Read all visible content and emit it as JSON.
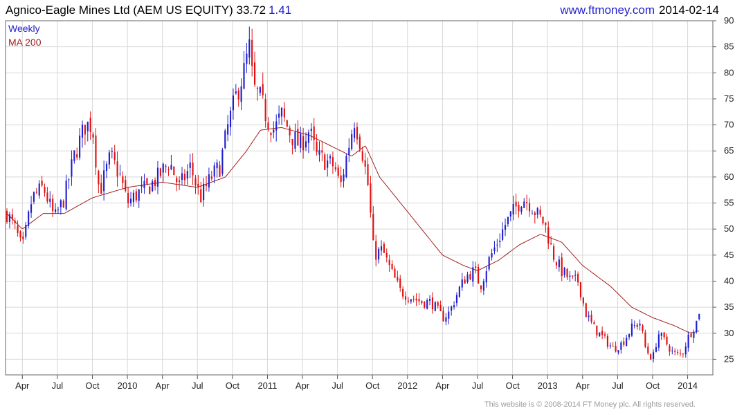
{
  "header": {
    "title": "Agnico-Eagle Mines Ltd (AEM US EQUITY) 33.72",
    "change": "1.41",
    "site": "www.ftmoney.com",
    "date": "2014-02-14"
  },
  "footer": {
    "copyright": "This website is © 2008-2014 FT Money plc. All rights reserved."
  },
  "colors": {
    "up": "#1f1fcf",
    "down": "#e01010",
    "ma": "#a02020",
    "grid": "#d8d8d8"
  },
  "chart_data": {
    "type": "candlestick",
    "frequency": "Weekly",
    "legend": [
      "Weekly",
      "MA 200"
    ],
    "legend_position": "top-left",
    "grid": true,
    "x_range": [
      2009.13,
      2014.18
    ],
    "ylim": [
      22,
      90
    ],
    "y_ticks": [
      25,
      30,
      35,
      40,
      45,
      50,
      55,
      60,
      65,
      70,
      75,
      80,
      85,
      90
    ],
    "x_ticks": [
      {
        "label": "Apr",
        "t": 2009.25
      },
      {
        "label": "Jul",
        "t": 2009.5
      },
      {
        "label": "Oct",
        "t": 2009.75
      },
      {
        "label": "2010",
        "t": 2010.0
      },
      {
        "label": "Apr",
        "t": 2010.25
      },
      {
        "label": "Jul",
        "t": 2010.5
      },
      {
        "label": "Oct",
        "t": 2010.75
      },
      {
        "label": "2011",
        "t": 2011.0
      },
      {
        "label": "Apr",
        "t": 2011.25
      },
      {
        "label": "Jul",
        "t": 2011.5
      },
      {
        "label": "Oct",
        "t": 2011.75
      },
      {
        "label": "2012",
        "t": 2012.0
      },
      {
        "label": "Apr",
        "t": 2012.25
      },
      {
        "label": "Jul",
        "t": 2012.5
      },
      {
        "label": "Oct",
        "t": 2012.75
      },
      {
        "label": "2013",
        "t": 2013.0
      },
      {
        "label": "Apr",
        "t": 2013.25
      },
      {
        "label": "Jul",
        "t": 2013.5
      },
      {
        "label": "Oct",
        "t": 2013.75
      },
      {
        "label": "2014",
        "t": 2014.0
      }
    ],
    "close_anchors": [
      [
        2009.14,
        53
      ],
      [
        2009.2,
        50
      ],
      [
        2009.25,
        46
      ],
      [
        2009.32,
        56
      ],
      [
        2009.4,
        58
      ],
      [
        2009.48,
        52
      ],
      [
        2009.55,
        56
      ],
      [
        2009.62,
        64
      ],
      [
        2009.7,
        70
      ],
      [
        2009.75,
        70
      ],
      [
        2009.8,
        57
      ],
      [
        2009.88,
        64
      ],
      [
        2009.95,
        60
      ],
      [
        2010.0,
        55
      ],
      [
        2010.08,
        57
      ],
      [
        2010.15,
        58
      ],
      [
        2010.22,
        60
      ],
      [
        2010.3,
        63
      ],
      [
        2010.37,
        58
      ],
      [
        2010.45,
        62
      ],
      [
        2010.52,
        56
      ],
      [
        2010.6,
        60
      ],
      [
        2010.66,
        62
      ],
      [
        2010.72,
        70
      ],
      [
        2010.78,
        76
      ],
      [
        2010.83,
        80
      ],
      [
        2010.87,
        85
      ],
      [
        2010.9,
        77
      ],
      [
        2010.95,
        75
      ],
      [
        2011.0,
        71
      ],
      [
        2011.05,
        69
      ],
      [
        2011.1,
        72
      ],
      [
        2011.17,
        68
      ],
      [
        2011.23,
        66
      ],
      [
        2011.3,
        69
      ],
      [
        2011.35,
        64
      ],
      [
        2011.42,
        63
      ],
      [
        2011.48,
        62
      ],
      [
        2011.52,
        58
      ],
      [
        2011.58,
        66
      ],
      [
        2011.62,
        71
      ],
      [
        2011.67,
        66
      ],
      [
        2011.72,
        58
      ],
      [
        2011.76,
        45
      ],
      [
        2011.82,
        46
      ],
      [
        2011.88,
        42
      ],
      [
        2011.95,
        38
      ],
      [
        2012.02,
        37
      ],
      [
        2012.1,
        36
      ],
      [
        2012.17,
        36
      ],
      [
        2012.25,
        33
      ],
      [
        2012.3,
        34
      ],
      [
        2012.36,
        38
      ],
      [
        2012.42,
        41
      ],
      [
        2012.48,
        42
      ],
      [
        2012.52,
        39
      ],
      [
        2012.58,
        44
      ],
      [
        2012.65,
        48
      ],
      [
        2012.7,
        51
      ],
      [
        2012.77,
        54
      ],
      [
        2012.82,
        56
      ],
      [
        2012.87,
        55
      ],
      [
        2012.92,
        53
      ],
      [
        2012.98,
        51
      ],
      [
        2013.04,
        45
      ],
      [
        2013.1,
        42
      ],
      [
        2013.17,
        40
      ],
      [
        2013.22,
        40
      ],
      [
        2013.27,
        34
      ],
      [
        2013.33,
        31
      ],
      [
        2013.4,
        29
      ],
      [
        2013.47,
        27
      ],
      [
        2013.53,
        28
      ],
      [
        2013.6,
        31
      ],
      [
        2013.66,
        32
      ],
      [
        2013.7,
        27
      ],
      [
        2013.75,
        25
      ],
      [
        2013.79,
        30
      ],
      [
        2013.85,
        28
      ],
      [
        2013.9,
        26
      ],
      [
        2013.96,
        26
      ],
      [
        2014.0,
        29
      ],
      [
        2014.06,
        32
      ],
      [
        2014.09,
        33.72
      ]
    ],
    "ma_anchors": [
      [
        2009.14,
        53
      ],
      [
        2009.25,
        50
      ],
      [
        2009.4,
        53
      ],
      [
        2009.55,
        53
      ],
      [
        2009.75,
        56
      ],
      [
        2010.0,
        58
      ],
      [
        2010.25,
        59
      ],
      [
        2010.5,
        58
      ],
      [
        2010.7,
        60
      ],
      [
        2010.85,
        65
      ],
      [
        2010.95,
        69
      ],
      [
        2011.1,
        69.5
      ],
      [
        2011.3,
        68
      ],
      [
        2011.45,
        66
      ],
      [
        2011.6,
        64
      ],
      [
        2011.7,
        66
      ],
      [
        2011.8,
        60
      ],
      [
        2011.95,
        55
      ],
      [
        2012.1,
        50
      ],
      [
        2012.25,
        45
      ],
      [
        2012.4,
        43
      ],
      [
        2012.5,
        42
      ],
      [
        2012.65,
        44
      ],
      [
        2012.8,
        47
      ],
      [
        2012.95,
        49
      ],
      [
        2013.1,
        47.5
      ],
      [
        2013.25,
        43
      ],
      [
        2013.45,
        39
      ],
      [
        2013.6,
        35
      ],
      [
        2013.75,
        33
      ],
      [
        2013.9,
        31.5
      ],
      [
        2014.02,
        30
      ],
      [
        2014.09,
        30.5
      ]
    ]
  }
}
